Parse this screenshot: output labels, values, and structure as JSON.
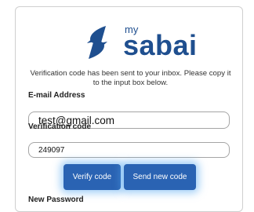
{
  "brand": {
    "small": "my",
    "name": "sabai",
    "color": "#1f4f8f"
  },
  "info_text": "Verification code has been sent to your inbox. Please copy it to the input box below.",
  "email": {
    "label": "E-mail Address",
    "value": "test@gmail.com"
  },
  "verification": {
    "label": "Verification code",
    "value": "249097"
  },
  "buttons": {
    "verify_label": "Verify code",
    "send_label": "Send new code",
    "color": "#2a63b3"
  },
  "new_password": {
    "label": "New Password"
  },
  "icons": {
    "logo": "sabai-logo-mark-icon"
  }
}
